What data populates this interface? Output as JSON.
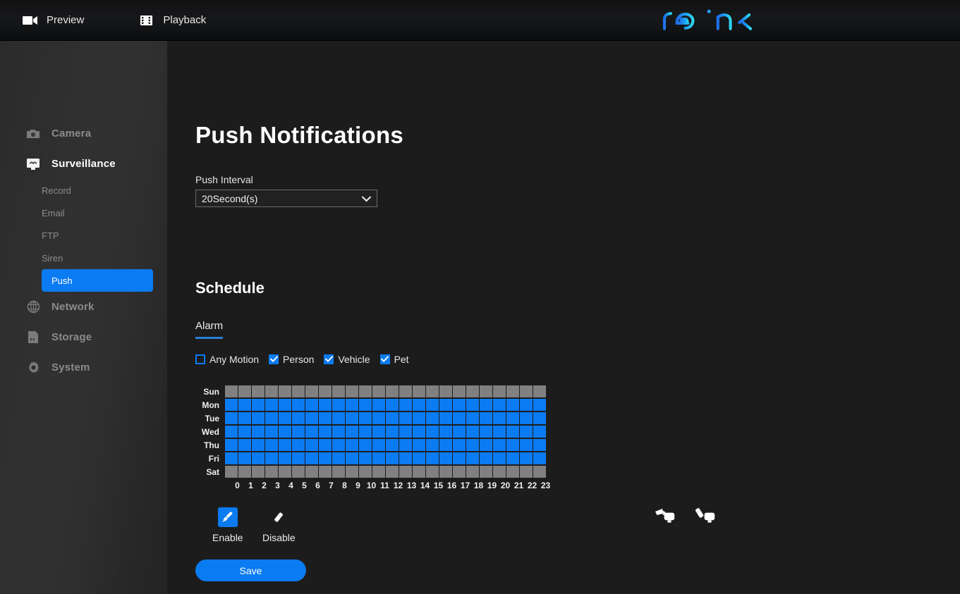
{
  "topbar": {
    "items": [
      {
        "label": "Preview",
        "icon": "camcorder-icon"
      },
      {
        "label": "Playback",
        "icon": "film-strip-icon"
      }
    ],
    "brand": "reolink"
  },
  "sidebar": {
    "items": [
      {
        "label": "Camera",
        "icon": "camera-icon",
        "active": false
      },
      {
        "label": "Surveillance",
        "icon": "monitor-icon",
        "active": true
      },
      {
        "label": "Network",
        "icon": "globe-icon",
        "active": false
      },
      {
        "label": "Storage",
        "icon": "sd-card-icon",
        "active": false
      },
      {
        "label": "System",
        "icon": "gear-icon",
        "active": false
      }
    ],
    "subitems": [
      {
        "label": "Record",
        "selected": false
      },
      {
        "label": "Email",
        "selected": false
      },
      {
        "label": "FTP",
        "selected": false
      },
      {
        "label": "Siren",
        "selected": false
      },
      {
        "label": "Push",
        "selected": true
      }
    ]
  },
  "main": {
    "title": "Push Notifications",
    "interval_label": "Push Interval",
    "interval_value": "20Second(s)",
    "interval_options": [
      "20Second(s)"
    ],
    "schedule_title": "Schedule",
    "tabs": [
      {
        "label": "Alarm",
        "active": true
      }
    ],
    "checkboxes": [
      {
        "label": "Any Motion",
        "checked": false
      },
      {
        "label": "Person",
        "checked": true
      },
      {
        "label": "Vehicle",
        "checked": true
      },
      {
        "label": "Pet",
        "checked": true
      }
    ],
    "tools": [
      {
        "label": "Enable",
        "icon": "paint-brush-icon",
        "selected": true
      },
      {
        "label": "Disable",
        "icon": "eraser-icon",
        "selected": false
      }
    ],
    "quick_tools": [
      {
        "name": "fill-all-icon",
        "title": "Enable All"
      },
      {
        "name": "clear-all-icon",
        "title": "Disable All"
      }
    ],
    "save_label": "Save"
  },
  "schedule_grid": {
    "days": [
      "Sun",
      "Mon",
      "Tue",
      "Wed",
      "Thu",
      "Fri",
      "Sat"
    ],
    "hours": [
      0,
      1,
      2,
      3,
      4,
      5,
      6,
      7,
      8,
      9,
      10,
      11,
      12,
      13,
      14,
      15,
      16,
      17,
      18,
      19,
      20,
      21,
      22,
      23
    ],
    "enabled": [
      [
        0,
        0,
        0,
        0,
        0,
        0,
        0,
        0,
        0,
        0,
        0,
        0,
        0,
        0,
        0,
        0,
        0,
        0,
        0,
        0,
        0,
        0,
        0,
        0
      ],
      [
        1,
        1,
        1,
        1,
        1,
        1,
        1,
        1,
        1,
        1,
        1,
        1,
        1,
        1,
        1,
        1,
        1,
        1,
        1,
        1,
        1,
        1,
        1,
        1
      ],
      [
        1,
        1,
        1,
        1,
        1,
        1,
        1,
        1,
        1,
        1,
        1,
        1,
        1,
        1,
        1,
        1,
        1,
        1,
        1,
        1,
        1,
        1,
        1,
        1
      ],
      [
        1,
        1,
        1,
        1,
        1,
        1,
        1,
        1,
        1,
        1,
        1,
        1,
        1,
        1,
        1,
        1,
        1,
        1,
        1,
        1,
        1,
        1,
        1,
        1
      ],
      [
        1,
        1,
        1,
        1,
        1,
        1,
        1,
        1,
        1,
        1,
        1,
        1,
        1,
        1,
        1,
        1,
        1,
        1,
        1,
        1,
        1,
        1,
        1,
        1
      ],
      [
        1,
        1,
        1,
        1,
        1,
        1,
        1,
        1,
        1,
        1,
        1,
        1,
        1,
        1,
        1,
        1,
        1,
        1,
        1,
        1,
        1,
        1,
        1,
        1
      ],
      [
        0,
        0,
        0,
        0,
        0,
        0,
        0,
        0,
        0,
        0,
        0,
        0,
        0,
        0,
        0,
        0,
        0,
        0,
        0,
        0,
        0,
        0,
        0,
        0
      ]
    ]
  },
  "colors": {
    "accent": "#0b7bf1",
    "cell_on": "#0b7bf1",
    "cell_off": "#808080",
    "bg": "#1c1c1c",
    "sidebar_bg": "#2f2f2f",
    "tab_underline": "#2a7fd4"
  }
}
